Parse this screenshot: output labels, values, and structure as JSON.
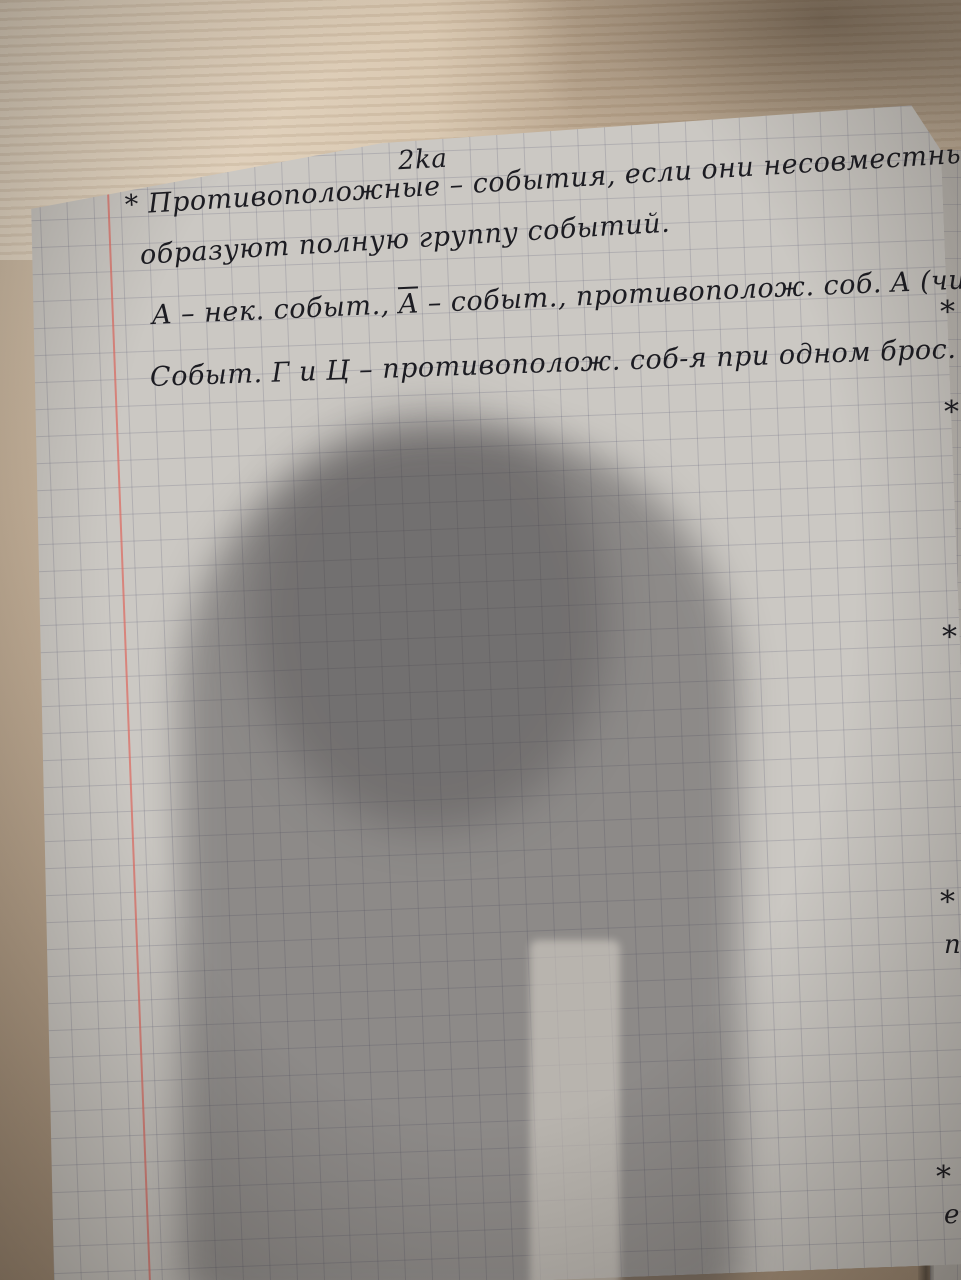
{
  "notebook": {
    "date": "2ka",
    "lines": [
      {
        "bullet": "*",
        "text": "Противоположные – события, если они несовместны и"
      },
      {
        "text": "образуют полную группу событий."
      },
      {
        "pre": "A – нек. событ., ",
        "over": "A",
        "post": " – событ., противополож. соб. A (чит.: не A)"
      },
      {
        "text": "Событ. Г и Ц – противополож. соб-я при одном брос. монеты."
      }
    ],
    "right_page_marks": [
      "*",
      "*",
      "*",
      "*",
      "*",
      "п",
      "е"
    ]
  }
}
